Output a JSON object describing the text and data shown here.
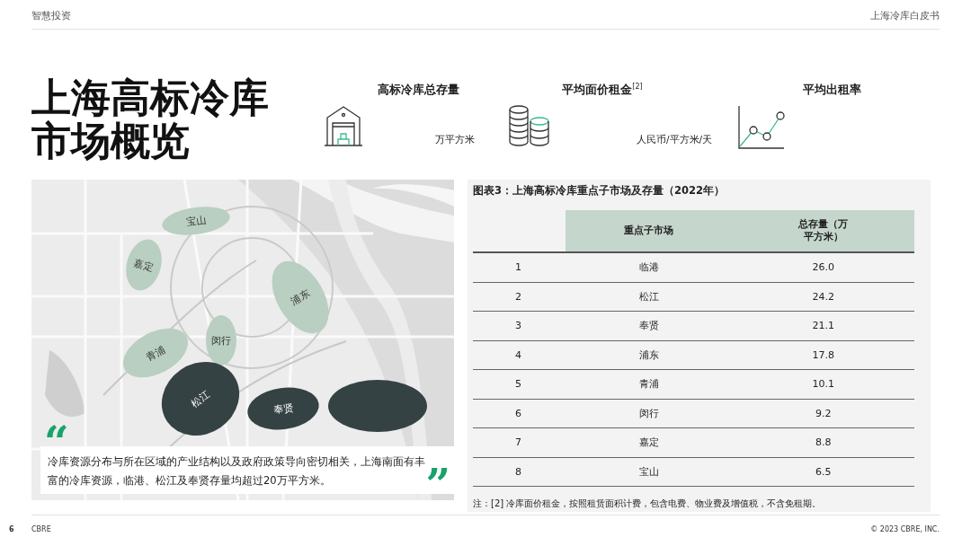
{
  "header": {
    "left": "智慧投资",
    "right": "上海冷库白皮书"
  },
  "title": [
    "上海高标冷库",
    "市场概览"
  ],
  "kpis": [
    {
      "kind": "warehouse",
      "title": "高标冷库总存量",
      "unit": "万平方米"
    },
    {
      "kind": "coins",
      "title": "平均面价租金$^{[2]}$",
      "unit": "人民币/平方米/天"
    },
    {
      "kind": "chart",
      "title": "平均出租率"
    }
  ],
  "map": {
    "kind": "picture",
    "regions": [
      {
        "label": "宝山",
        "kind": "light"
      },
      {
        "label": "嘉定",
        "kind": "light"
      },
      {
        "label": "浦东",
        "kind": "light"
      },
      {
        "label": "闵行",
        "kind": "light"
      },
      {
        "label": "青浦",
        "kind": "light"
      },
      {
        "label": "松江",
        "kind": "dark"
      },
      {
        "label": "奉贤",
        "kind": "dark"
      },
      {
        "kind": "dark"
      }
    ]
  },
  "quote": {
    "open": "“",
    "close": "”",
    "text": "冷库资源分布与所在区域的产业结构以及政府政策导向密切相关，上海南面有丰富的冷库资源，临港、松江及奉贤存量均超过20万平方米。"
  },
  "table": {
    "caption": "图表3：上海高标冷库重点子市场及存量（2022年）",
    "columns": [
      "",
      "重点子市场",
      "总存量（万平方米）"
    ],
    "rows": [
      [
        "1",
        "临港",
        "26.0"
      ],
      [
        "2",
        "松江",
        "24.2"
      ],
      [
        "3",
        "奉贤",
        "21.1"
      ],
      [
        "4",
        "浦东",
        "17.8"
      ],
      [
        "5",
        "青浦",
        "10.1"
      ],
      [
        "6",
        "闵行",
        "9.2"
      ],
      [
        "7",
        "嘉定",
        "8.8"
      ],
      [
        "8",
        "宝山",
        "6.5"
      ]
    ],
    "note": "注：[2] 冷库面价租金，按照租赁面积计费，包含电费、物业费及增值税，不含免租期。"
  },
  "footer": {
    "page": "6",
    "brand": "CBRE",
    "copyright": "© 2023 CBRE, INC."
  }
}
